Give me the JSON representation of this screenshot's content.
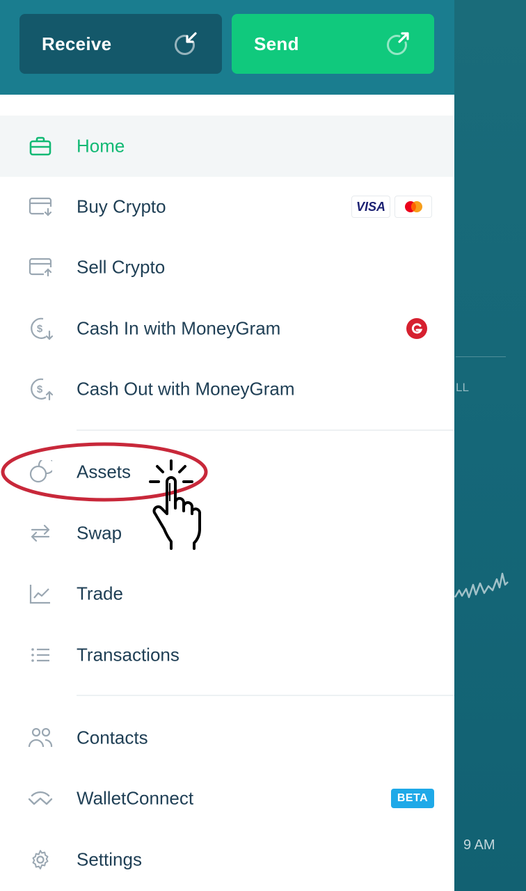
{
  "header": {
    "receive_label": "Receive",
    "send_label": "Send"
  },
  "menu": {
    "home": "Home",
    "buy_crypto": "Buy Crypto",
    "sell_crypto": "Sell Crypto",
    "cash_in": "Cash In with MoneyGram",
    "cash_out": "Cash Out with MoneyGram",
    "assets": "Assets",
    "swap": "Swap",
    "trade": "Trade",
    "transactions": "Transactions",
    "contacts": "Contacts",
    "walletconnect": "WalletConnect",
    "settings": "Settings"
  },
  "badges": {
    "visa": "VISA",
    "beta": "BETA"
  },
  "background": {
    "label_fragment": "LL",
    "time_fragment": "9 AM"
  },
  "colors": {
    "header": "#1a7d8f",
    "receive_button": "#14586a",
    "send_button": "#10c97d",
    "active_item": "#12b974",
    "text": "#1f3f55",
    "annotation_red": "#c8283a"
  }
}
